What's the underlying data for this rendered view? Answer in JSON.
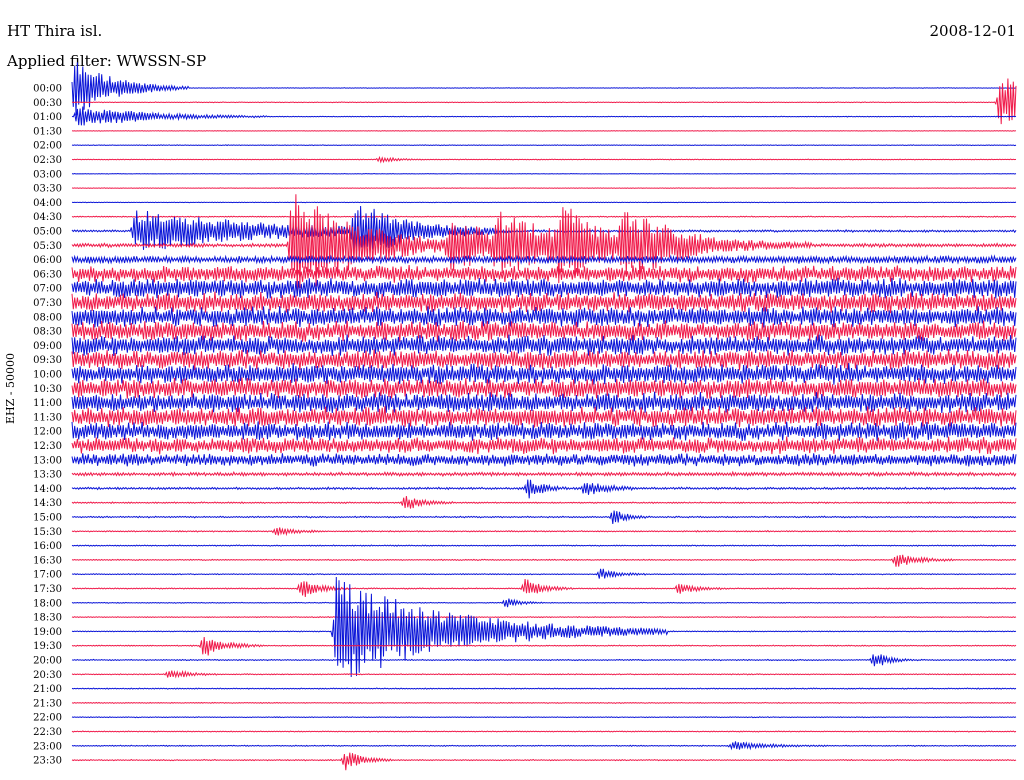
{
  "header": {
    "station": "HT Thira isl.",
    "date": "2008-12-01",
    "filter": "Applied filter: WWSSN-SP"
  },
  "chart_data": {
    "type": "line",
    "title": "HT Thira isl.",
    "ylabel": "EHZ - 50000",
    "row_interval_minutes": 30,
    "series_colors": [
      "#0a14d8",
      "#f01a4a"
    ],
    "rows": [
      {
        "label": "00:00",
        "noise": 0.3
      },
      {
        "label": "00:30",
        "noise": 0.4
      },
      {
        "label": "01:00",
        "noise": 0.4
      },
      {
        "label": "01:30",
        "noise": 0.3
      },
      {
        "label": "02:00",
        "noise": 0.4
      },
      {
        "label": "02:30",
        "noise": 0.4
      },
      {
        "label": "03:00",
        "noise": 0.3
      },
      {
        "label": "03:30",
        "noise": 0.3
      },
      {
        "label": "04:00",
        "noise": 0.3
      },
      {
        "label": "04:30",
        "noise": 0.6
      },
      {
        "label": "05:00",
        "noise": 1.2
      },
      {
        "label": "05:30",
        "noise": 2.0
      },
      {
        "label": "06:00",
        "noise": 4.0
      },
      {
        "label": "06:30",
        "noise": 9.0
      },
      {
        "label": "07:00",
        "noise": 11.0
      },
      {
        "label": "07:30",
        "noise": 11.0
      },
      {
        "label": "08:00",
        "noise": 11.0
      },
      {
        "label": "08:30",
        "noise": 11.0
      },
      {
        "label": "09:00",
        "noise": 11.0
      },
      {
        "label": "09:30",
        "noise": 11.0
      },
      {
        "label": "10:00",
        "noise": 11.0
      },
      {
        "label": "10:30",
        "noise": 11.0
      },
      {
        "label": "11:00",
        "noise": 11.0
      },
      {
        "label": "11:30",
        "noise": 11.0
      },
      {
        "label": "12:00",
        "noise": 10.0
      },
      {
        "label": "12:30",
        "noise": 9.0
      },
      {
        "label": "13:00",
        "noise": 7.0
      },
      {
        "label": "13:30",
        "noise": 2.0
      },
      {
        "label": "14:00",
        "noise": 1.2
      },
      {
        "label": "14:30",
        "noise": 0.8
      },
      {
        "label": "15:00",
        "noise": 0.8
      },
      {
        "label": "15:30",
        "noise": 0.7
      },
      {
        "label": "16:00",
        "noise": 0.6
      },
      {
        "label": "16:30",
        "noise": 0.6
      },
      {
        "label": "17:00",
        "noise": 0.6
      },
      {
        "label": "17:30",
        "noise": 0.6
      },
      {
        "label": "18:00",
        "noise": 0.5
      },
      {
        "label": "18:30",
        "noise": 0.5
      },
      {
        "label": "19:00",
        "noise": 0.5
      },
      {
        "label": "19:30",
        "noise": 0.6
      },
      {
        "label": "20:00",
        "noise": 0.6
      },
      {
        "label": "20:30",
        "noise": 0.6
      },
      {
        "label": "21:00",
        "noise": 0.6
      },
      {
        "label": "21:30",
        "noise": 0.5
      },
      {
        "label": "22:00",
        "noise": 0.5
      },
      {
        "label": "22:30",
        "noise": 0.5
      },
      {
        "label": "23:00",
        "noise": 0.6
      },
      {
        "label": "23:30",
        "noise": 0.6
      }
    ],
    "events": [
      {
        "row": 0,
        "minute": 0.1,
        "amplitude": 30,
        "duration": 1.2
      },
      {
        "row": 1,
        "minute": 29.5,
        "amplitude": 28,
        "duration": 1.5
      },
      {
        "row": 2,
        "minute": 0.2,
        "amplitude": 12,
        "duration": 2.0
      },
      {
        "row": 5,
        "minute": 9.8,
        "amplitude": 3,
        "duration": 0.5
      },
      {
        "row": 10,
        "minute": 2.0,
        "amplitude": 22,
        "duration": 4.0
      },
      {
        "row": 10,
        "minute": 9.0,
        "amplitude": 28,
        "duration": 1.5
      },
      {
        "row": 11,
        "minute": 7.0,
        "amplitude": 60,
        "duration": 2.0
      },
      {
        "row": 11,
        "minute": 12.0,
        "amplitude": 26,
        "duration": 1.5
      },
      {
        "row": 11,
        "minute": 15.5,
        "amplitude": 30,
        "duration": 1.5
      },
      {
        "row": 11,
        "minute": 13.5,
        "amplitude": 30,
        "duration": 2.0
      },
      {
        "row": 11,
        "minute": 17.5,
        "amplitude": 28,
        "duration": 2.0
      },
      {
        "row": 28,
        "minute": 16.3,
        "amplitude": 8,
        "duration": 0.6
      },
      {
        "row": 28,
        "minute": 14.5,
        "amplitude": 12,
        "duration": 0.4
      },
      {
        "row": 29,
        "minute": 10.6,
        "amplitude": 8,
        "duration": 0.5
      },
      {
        "row": 30,
        "minute": 17.2,
        "amplitude": 8,
        "duration": 0.4
      },
      {
        "row": 31,
        "minute": 6.5,
        "amplitude": 5,
        "duration": 0.5
      },
      {
        "row": 33,
        "minute": 26.2,
        "amplitude": 8,
        "duration": 0.6
      },
      {
        "row": 34,
        "minute": 16.8,
        "amplitude": 6,
        "duration": 0.5
      },
      {
        "row": 35,
        "minute": 7.3,
        "amplitude": 10,
        "duration": 0.5
      },
      {
        "row": 35,
        "minute": 14.4,
        "amplitude": 10,
        "duration": 0.5
      },
      {
        "row": 35,
        "minute": 19.3,
        "amplitude": 6,
        "duration": 0.5
      },
      {
        "row": 36,
        "minute": 13.8,
        "amplitude": 5,
        "duration": 0.4
      },
      {
        "row": 38,
        "minute": 8.4,
        "amplitude": 55,
        "duration": 3.5
      },
      {
        "row": 39,
        "minute": 4.2,
        "amplitude": 12,
        "duration": 0.6
      },
      {
        "row": 40,
        "minute": 25.5,
        "amplitude": 9,
        "duration": 0.4
      },
      {
        "row": 41,
        "minute": 3.1,
        "amplitude": 6,
        "duration": 0.5
      },
      {
        "row": 46,
        "minute": 21.0,
        "amplitude": 5,
        "duration": 1.0
      },
      {
        "row": 47,
        "minute": 8.7,
        "amplitude": 10,
        "duration": 0.5
      }
    ]
  }
}
